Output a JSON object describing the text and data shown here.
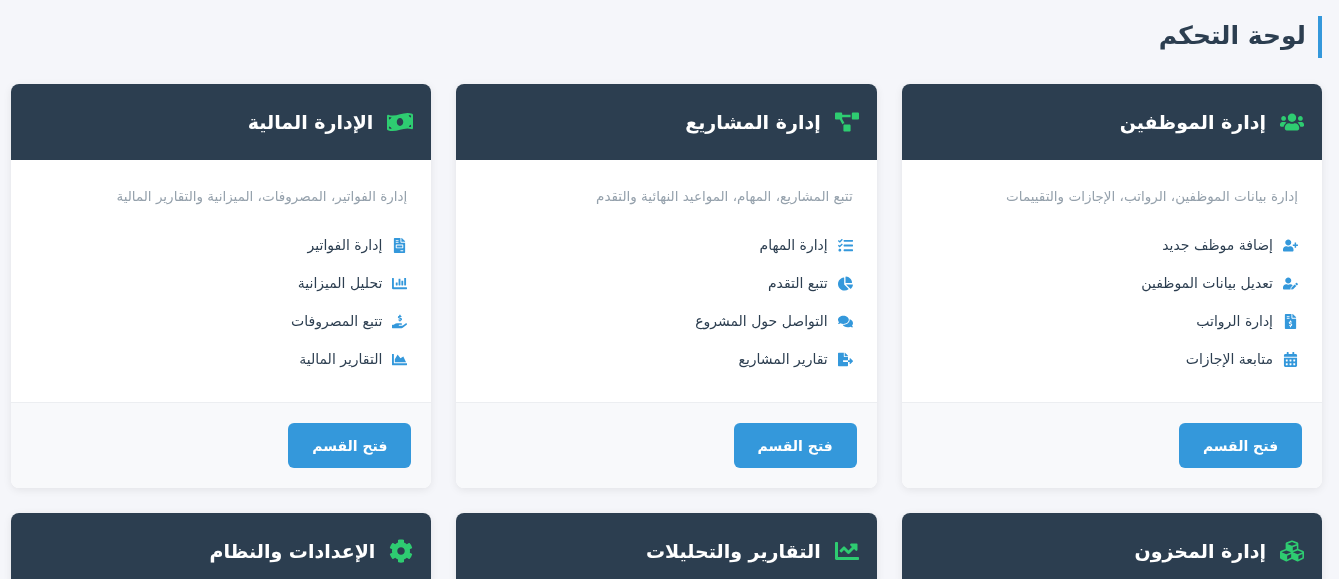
{
  "page_title": "لوحة التحكم",
  "cards": [
    {
      "title": "إدارة الموظفين",
      "description": "إدارة بيانات الموظفين، الرواتب، الإجازات والتقييمات",
      "items": [
        "إضافة موظف جديد",
        "تعديل بيانات الموظفين",
        "إدارة الرواتب",
        "متابعة الإجازات"
      ],
      "button": "فتح القسم"
    },
    {
      "title": "إدارة المشاريع",
      "description": "تتبع المشاريع، المهام، المواعيد النهائية والتقدم",
      "items": [
        "إدارة المهام",
        "تتبع التقدم",
        "التواصل حول المشروع",
        "تقارير المشاريع"
      ],
      "button": "فتح القسم"
    },
    {
      "title": "الإدارة المالية",
      "description": "إدارة الفواتير، المصروفات، الميزانية والتقارير المالية",
      "items": [
        "إدارة الفواتير",
        "تحليل الميزانية",
        "تتبع المصروفات",
        "التقارير المالية"
      ],
      "button": "فتح القسم"
    },
    {
      "title": "إدارة المخزون"
    },
    {
      "title": "التقارير والتحليلات"
    },
    {
      "title": "الإعدادات والنظام"
    }
  ]
}
